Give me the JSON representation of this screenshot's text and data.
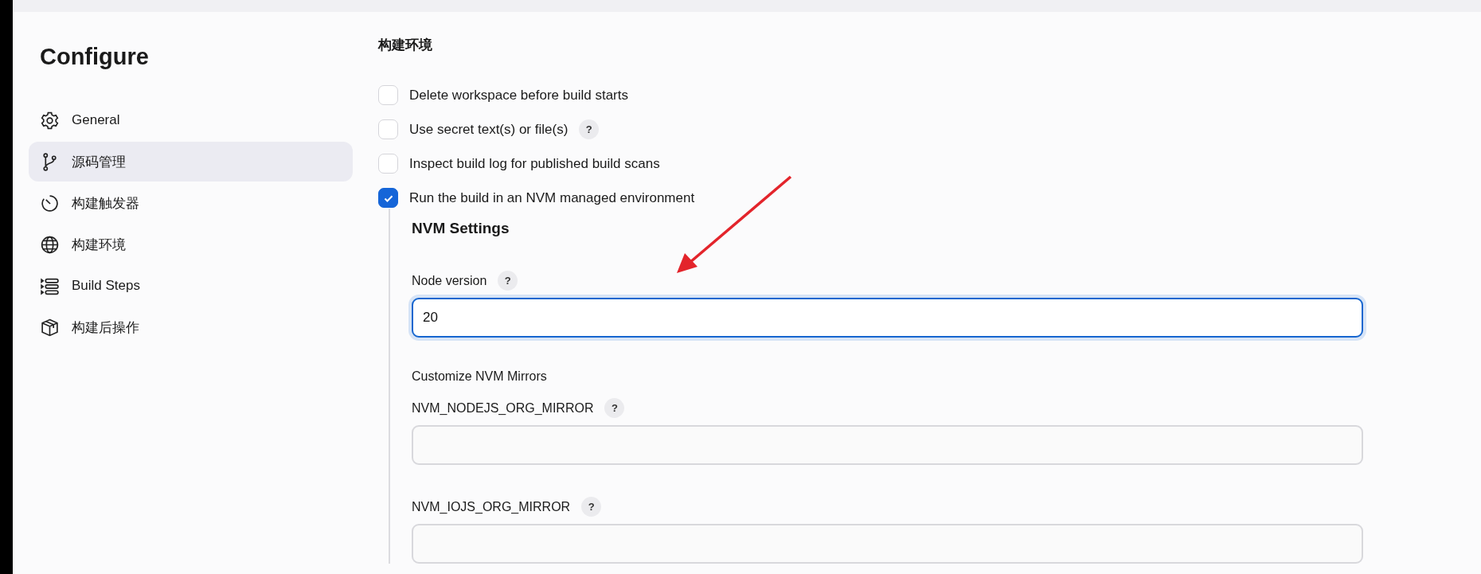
{
  "sidebar": {
    "title": "Configure",
    "items": [
      {
        "label": "General",
        "selected": false
      },
      {
        "label": "源码管理",
        "selected": true
      },
      {
        "label": "构建触发器",
        "selected": false
      },
      {
        "label": "构建环境",
        "selected": false
      },
      {
        "label": "Build Steps",
        "selected": false
      },
      {
        "label": "构建后操作",
        "selected": false
      }
    ]
  },
  "section": {
    "heading": "构建环境",
    "options": [
      {
        "label": "Delete workspace before build starts",
        "checked": false
      },
      {
        "label": "Use secret text(s) or file(s)",
        "checked": false,
        "help": "?"
      },
      {
        "label": "Inspect build log for published build scans",
        "checked": false
      },
      {
        "label": "Run the build in an NVM managed environment",
        "checked": true
      }
    ],
    "nvm": {
      "heading": "NVM Settings",
      "node_version": {
        "label": "Node version",
        "help": "?",
        "value": "20",
        "focused": true
      },
      "mirrors_heading": "Customize NVM Mirrors",
      "mirrors": [
        {
          "label": "NVM_NODEJS_ORG_MIRROR",
          "help": "?",
          "focused": false
        },
        {
          "label": "NVM_IOJS_ORG_MIRROR",
          "help": "?",
          "focused": false
        }
      ]
    }
  }
}
